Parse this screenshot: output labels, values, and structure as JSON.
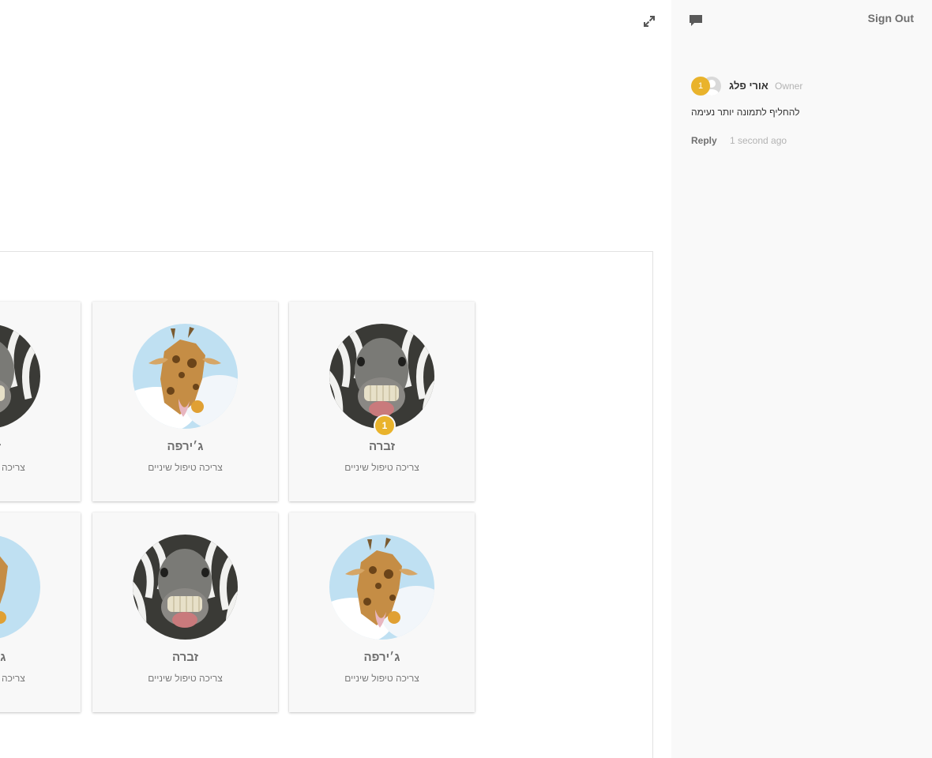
{
  "board": {
    "cards": [
      {
        "animal": "zebra",
        "title": "זברה",
        "subtitle": "צריכה טיפול שיניים",
        "badge": "1"
      },
      {
        "animal": "giraffe",
        "title": "ג׳ירפה",
        "subtitle": "צריכה טיפול שיניים",
        "badge": ""
      },
      {
        "animal": "zebra",
        "title": "זברה",
        "subtitle": "צריכה טיפול שיניים",
        "badge": ""
      },
      {
        "animal": "giraffe",
        "title": "ג׳ירפה",
        "subtitle": "צריכה טיפול שיניים",
        "badge": ""
      },
      {
        "animal": "zebra",
        "title": "זברה",
        "subtitle": "צריכה טיפול שיניים",
        "badge": ""
      },
      {
        "animal": "giraffe",
        "title": "ג׳ירפה",
        "subtitle": "צריכה טיפול שיניים",
        "badge": ""
      }
    ]
  },
  "sidebar": {
    "sign_out_label": "Sign Out",
    "comment": {
      "number": "1",
      "author": "אורי פלג",
      "role": "Owner",
      "text": "להחליף לתמונה יותר נעימה",
      "reply_label": "Reply",
      "time": "1 second ago"
    }
  },
  "icons": {
    "expand": "expand-icon",
    "comments": "comments-icon"
  },
  "colors": {
    "badge": "#e9b32c",
    "sidebar_bg": "#f9f9f9",
    "card_bg": "#f8f8f8"
  }
}
